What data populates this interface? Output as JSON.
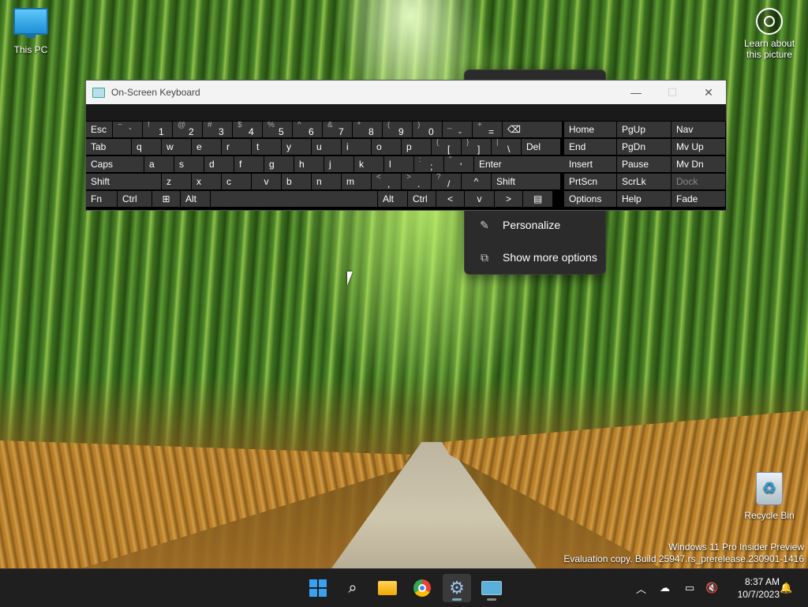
{
  "desktop": {
    "this_pc": "This PC",
    "learn_about": "Learn about this picture",
    "recycle_bin": "Recycle Bin"
  },
  "watermark": {
    "line1": "Windows 11 Pro Insider Preview",
    "line2": "Evaluation copy. Build 25947.rs_prerelease.230901-1416"
  },
  "context_menu": {
    "items": [
      {
        "label": "Personalize",
        "icon": "pen-icon"
      },
      {
        "label": "Show more options",
        "icon": "expand-icon"
      }
    ]
  },
  "osk": {
    "title": "On-Screen Keyboard",
    "row1": [
      {
        "label": "Esc"
      },
      {
        "sh": "~",
        "mn": "`"
      },
      {
        "sh": "!",
        "mn": "1"
      },
      {
        "sh": "@",
        "mn": "2"
      },
      {
        "sh": "#",
        "mn": "3"
      },
      {
        "sh": "$",
        "mn": "4"
      },
      {
        "sh": "%",
        "mn": "5"
      },
      {
        "sh": "^",
        "mn": "6"
      },
      {
        "sh": "&",
        "mn": "7"
      },
      {
        "sh": "*",
        "mn": "8"
      },
      {
        "sh": "(",
        "mn": "9"
      },
      {
        "sh": ")",
        "mn": "0"
      },
      {
        "sh": "_",
        "mn": "-"
      },
      {
        "sh": "+",
        "mn": "="
      },
      {
        "label": "⌫"
      }
    ],
    "row2": [
      "Tab",
      "q",
      "w",
      "e",
      "r",
      "t",
      "y",
      "u",
      "i",
      "o",
      "p",
      {
        "sh": "{",
        "mn": "["
      },
      {
        "sh": "}",
        "mn": "]"
      },
      {
        "sh": "|",
        "mn": "\\"
      },
      "Del"
    ],
    "row3": [
      "Caps",
      "a",
      "s",
      "d",
      "f",
      "g",
      "h",
      "j",
      "k",
      "l",
      {
        "sh": ":",
        "mn": ";"
      },
      {
        "sh": "\"",
        "mn": "'"
      },
      "Enter"
    ],
    "row4": [
      "Shift",
      "z",
      "x",
      "c",
      "v",
      "b",
      "n",
      "m",
      {
        "sh": "<",
        "mn": ","
      },
      {
        "sh": ">",
        "mn": "."
      },
      {
        "sh": "?",
        "mn": "/"
      },
      "^",
      "Shift"
    ],
    "row5": [
      "Fn",
      "Ctrl",
      "⊞",
      "Alt",
      "",
      "Alt",
      "Ctrl",
      "<",
      "v",
      ">",
      "▤"
    ],
    "nav": [
      [
        "Home",
        "PgUp",
        "Nav"
      ],
      [
        "End",
        "PgDn",
        "Mv Up"
      ],
      [
        "Insert",
        "Pause",
        "Mv Dn"
      ],
      [
        "PrtScn",
        "ScrLk",
        "Dock"
      ],
      [
        "Options",
        "Help",
        "Fade"
      ]
    ]
  },
  "taskbar": {
    "apps": [
      "start-button",
      "search-button",
      "file-explorer",
      "chrome",
      "settings",
      "on-screen-keyboard"
    ],
    "time": "8:37 AM",
    "date": "10/7/2023"
  }
}
